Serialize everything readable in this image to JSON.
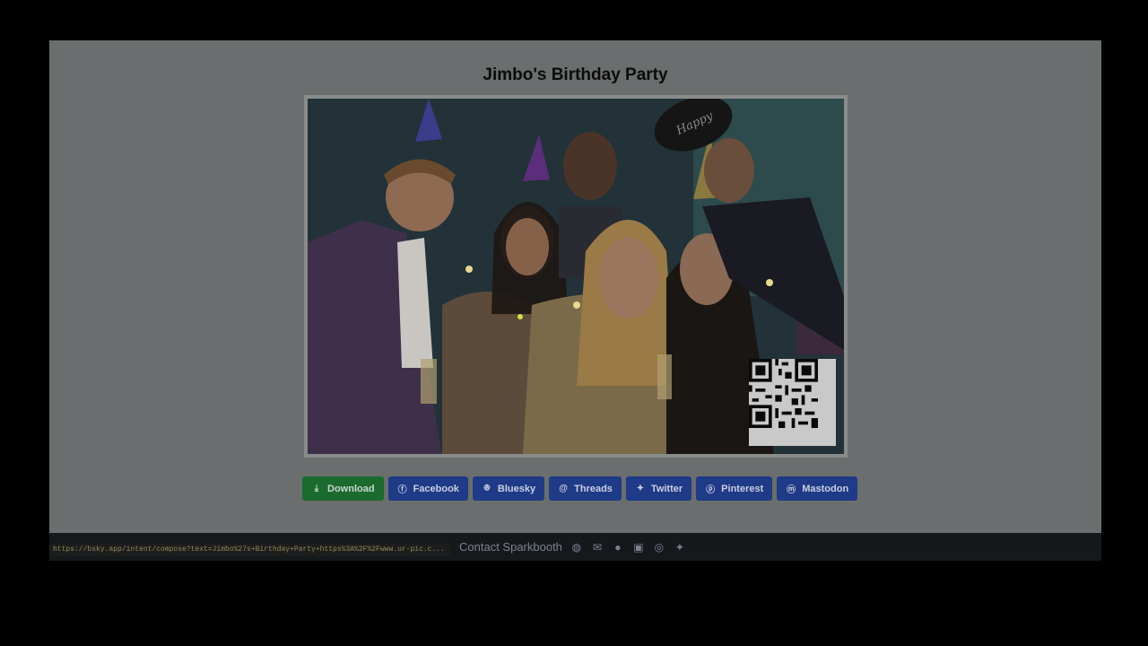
{
  "page": {
    "title": "Jimbo's Birthday Party"
  },
  "photo": {
    "subject": "group-party-photo",
    "hat_sign_text": "Happy New Year",
    "has_qr_code": true
  },
  "share_buttons": [
    {
      "label": "Download",
      "icon": "download-icon",
      "color": "#1b6a2e"
    },
    {
      "label": "Facebook",
      "icon": "facebook-icon",
      "color": "#1f3a86"
    },
    {
      "label": "Bluesky",
      "icon": "bluesky-icon",
      "color": "#1f3a86"
    },
    {
      "label": "Threads",
      "icon": "threads-icon",
      "color": "#1f3a86"
    },
    {
      "label": "Twitter",
      "icon": "twitter-icon",
      "color": "#1f3a86"
    },
    {
      "label": "Pinterest",
      "icon": "pinterest-icon",
      "color": "#1f3a86"
    },
    {
      "label": "Mastodon",
      "icon": "mastodon-icon",
      "color": "#1f3a86"
    }
  ],
  "footer": {
    "contact_label": "Contact Sparkbooth",
    "icons": [
      "globe-icon",
      "mail-icon",
      "facebook-icon",
      "linkedin-icon",
      "instagram-icon",
      "twitter-icon"
    ]
  },
  "status_bar": {
    "url": "https://bsky.app/intent/compose?text=Jimbo%27s+Birthday+Party+https%3A%2F%2Fwww.ur-pic.c..."
  }
}
